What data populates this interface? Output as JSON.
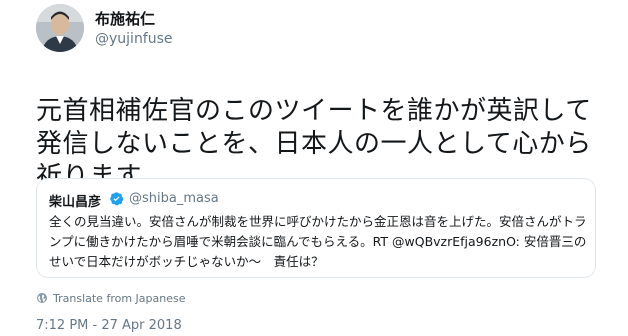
{
  "tweet": {
    "author": {
      "display_name": "布施祐仁",
      "handle": "@yujinfuse",
      "avatar_icon": "user-avatar"
    },
    "text": "元首相補佐官のこのツイートを誰かが英訳して発信しないことを、日本人の一人として心から祈ります。",
    "quoted_tweet": {
      "author_name": "柴山昌彦",
      "verified": true,
      "verified_icon": "verified-badge-icon",
      "verified_color": "#1da1f2",
      "handle": "@shiba_masa",
      "text": "全くの見当違い。安倍さんが制裁を世界に呼びかけたから金正恩は音を上げた。安倍さんがトランプに働きかけたから眉唾で米朝会談に臨んでもらえる。RT @wQBvzrEfja96znO: 安倍晋三のせいで日本だけがボッチじゃないか〜　責任は？"
    },
    "translate_label": "Translate from Japanese",
    "translate_icon": "globe-icon",
    "timestamp": "7:12 PM - 27 Apr 2018"
  },
  "colors": {
    "text": "#14171a",
    "secondary": "#657786",
    "border": "#e1e8ed",
    "accent": "#1da1f2"
  }
}
